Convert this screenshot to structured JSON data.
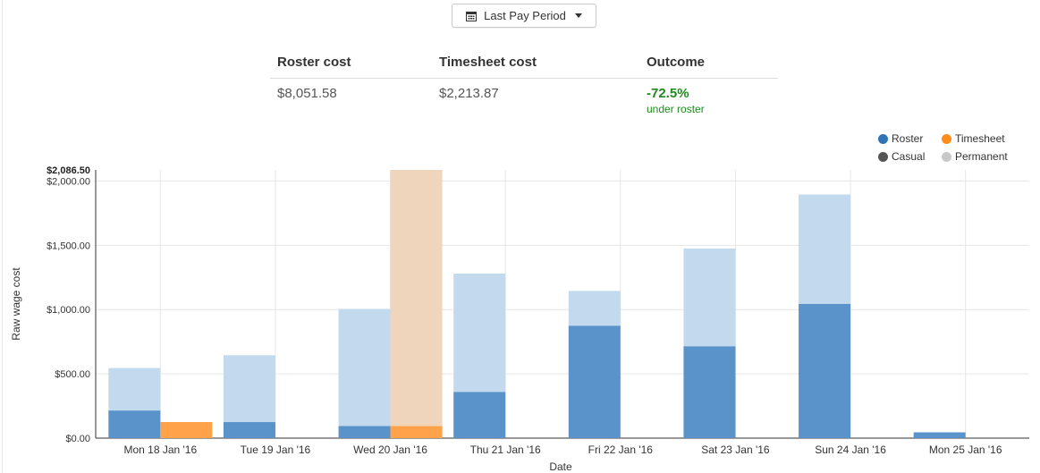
{
  "filter": {
    "label": "Last Pay Period",
    "icon": "calendar-icon"
  },
  "summary": {
    "headers": [
      "Roster cost",
      "Timesheet cost",
      "Outcome"
    ],
    "roster_cost": "$8,051.58",
    "timesheet_cost": "$2,213.87",
    "outcome_value": "-72.5%",
    "outcome_note": "under roster"
  },
  "legend": [
    {
      "label": "Roster",
      "color": "#2f74b5"
    },
    {
      "label": "Timesheet",
      "color": "#ff8c1a"
    },
    {
      "label": "Casual",
      "color": "#555555"
    },
    {
      "label": "Permanent",
      "color": "#c8c8c8"
    }
  ],
  "chart_data": {
    "type": "bar",
    "xlabel": "Date",
    "ylabel": "Raw wage cost",
    "ylim": [
      0,
      2086.5
    ],
    "y_max_label": "$2,086.50",
    "y_ticks": [
      0,
      500,
      1000,
      1500,
      2000
    ],
    "y_tick_labels": [
      "$0.00",
      "$500.00",
      "$1,000.00",
      "$1,500.00",
      "$2,000.00"
    ],
    "grid": true,
    "legend_position": "top-right",
    "categories": [
      "Mon 18 Jan '16",
      "Tue 19 Jan '16",
      "Wed 20 Jan '16",
      "Thu 21 Jan '16",
      "Fri 22 Jan '16",
      "Sat 23 Jan '16",
      "Sun 24 Jan '16",
      "Mon 25 Jan '16"
    ],
    "series": [
      {
        "name": "Roster",
        "group": "roster",
        "type": "Casual",
        "color": "#5a93c9",
        "values": [
          215,
          125,
          95,
          360,
          875,
          715,
          1045,
          45
        ]
      },
      {
        "name": "Roster",
        "group": "roster",
        "type": "Permanent",
        "color": "#c2d9ee",
        "values": [
          330,
          520,
          910,
          920,
          270,
          760,
          850,
          0
        ]
      },
      {
        "name": "Timesheet",
        "group": "timesheet",
        "type": "Casual",
        "color": "#ffa24a",
        "values": [
          125,
          0,
          95,
          0,
          0,
          0,
          0,
          0
        ]
      },
      {
        "name": "Timesheet",
        "group": "timesheet",
        "type": "Permanent",
        "color": "#f0d5bd",
        "values": [
          0,
          0,
          1991.5,
          0,
          0,
          0,
          0,
          0
        ]
      }
    ]
  }
}
